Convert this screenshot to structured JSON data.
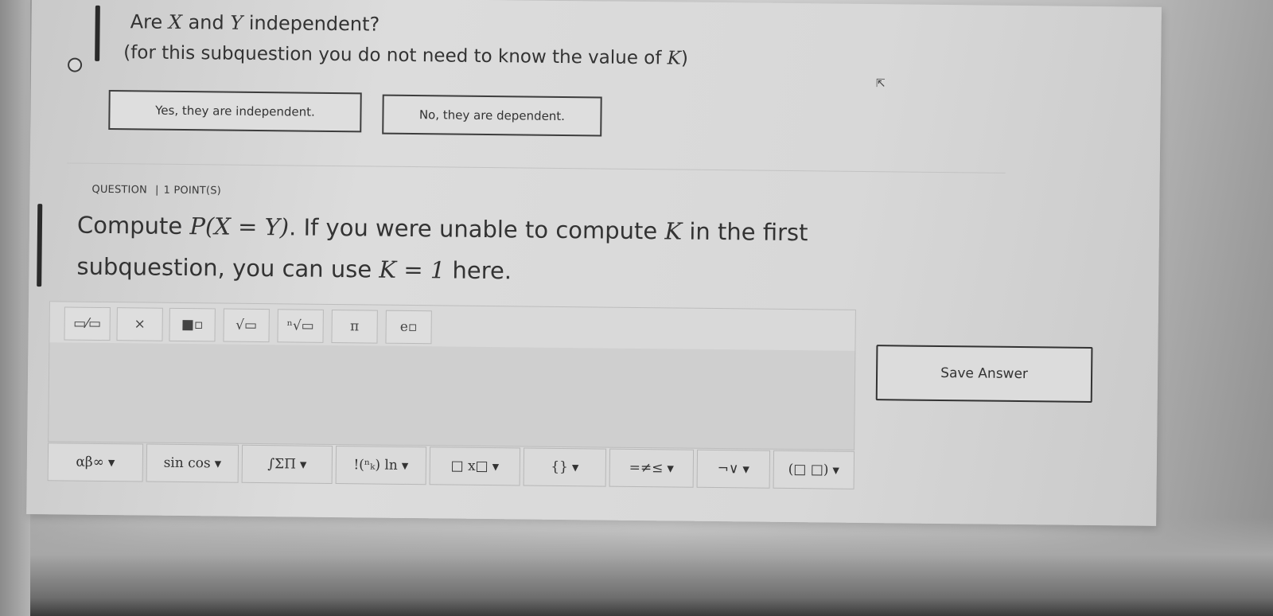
{
  "subquestion": {
    "title_prefix": "Are ",
    "title_var1": "X",
    "title_mid": " and ",
    "title_var2": "Y",
    "title_suffix": " independent?",
    "subtitle_prefix": "(for this subquestion you do not need to know the value of ",
    "subtitle_var": "K",
    "subtitle_suffix": ")",
    "options": [
      {
        "label": "Yes, they are independent."
      },
      {
        "label": "No, they are dependent."
      }
    ]
  },
  "question": {
    "label": "QUESTION",
    "separator": "|",
    "points": "1 POINT(S)",
    "text_1": "Compute ",
    "math_1": "P(X = Y)",
    "text_2": ". If you were unable to compute ",
    "math_2": "K",
    "text_3": " in the first subquestion, you can use ",
    "math_3": "K = 1",
    "text_4": " here."
  },
  "editor": {
    "top_toolbar": [
      {
        "icon": "fraction-icon",
        "glyph": "▭⁄▭"
      },
      {
        "icon": "multiply-icon",
        "glyph": "×"
      },
      {
        "icon": "superscript-icon",
        "glyph": "■▫"
      },
      {
        "icon": "square-root-icon",
        "glyph": "√▭"
      },
      {
        "icon": "nth-root-icon",
        "glyph": "ⁿ√▭"
      },
      {
        "icon": "pi-icon",
        "glyph": "π"
      },
      {
        "icon": "exponential-icon",
        "glyph": "e▫"
      }
    ],
    "bottom_toolbar": [
      {
        "icon": "greek-letters-icon",
        "glyph": "αβ∞"
      },
      {
        "icon": "trig-functions-icon",
        "glyph": "sin cos"
      },
      {
        "icon": "calculus-icon",
        "glyph": "∫ΣΠ"
      },
      {
        "icon": "combinatorics-icon",
        "glyph": "!(ⁿₖ) ln"
      },
      {
        "icon": "subscript-icon",
        "glyph": "□ x□"
      },
      {
        "icon": "braces-icon",
        "glyph": "{}"
      },
      {
        "icon": "relations-icon",
        "glyph": "=≠≤"
      },
      {
        "icon": "logic-icon",
        "glyph": "¬∨"
      },
      {
        "icon": "matrix-icon",
        "glyph": "(□ □)"
      }
    ],
    "dropdown_caret": "▼"
  },
  "save_label": "Save Answer"
}
